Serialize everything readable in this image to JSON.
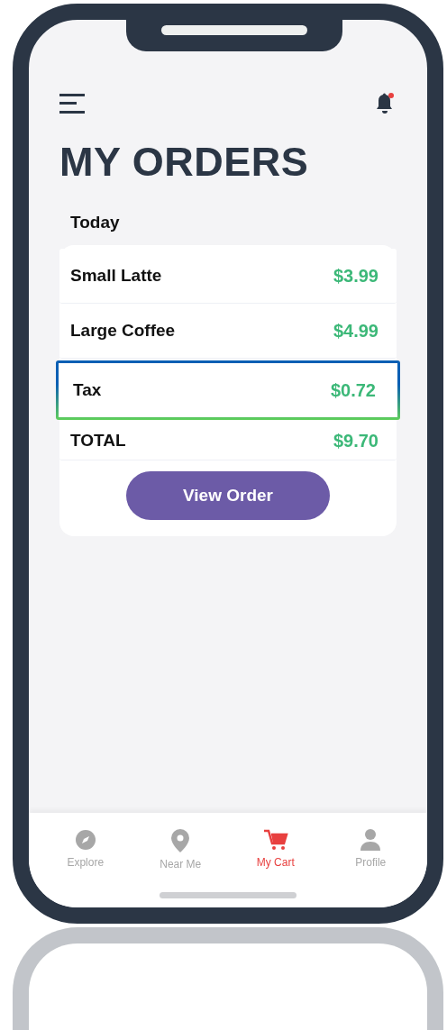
{
  "header": {
    "title": "MY ORDERS",
    "notification": true
  },
  "section": "Today",
  "lines": [
    {
      "label": "Small Latte",
      "amount": "$3.99",
      "highlighted": false,
      "kind": "item"
    },
    {
      "label": "Large Coffee",
      "amount": "$4.99",
      "highlighted": false,
      "kind": "item"
    },
    {
      "label": "Tax",
      "amount": "$0.72",
      "highlighted": true,
      "kind": "item"
    },
    {
      "label": "TOTAL",
      "amount": "$9.70",
      "highlighted": false,
      "kind": "total"
    }
  ],
  "button": "View Order",
  "nav": [
    {
      "label": "Explore",
      "selected": false
    },
    {
      "label": "Near Me",
      "selected": false
    },
    {
      "label": "My Cart",
      "selected": true
    },
    {
      "label": "Profile",
      "selected": false
    }
  ]
}
